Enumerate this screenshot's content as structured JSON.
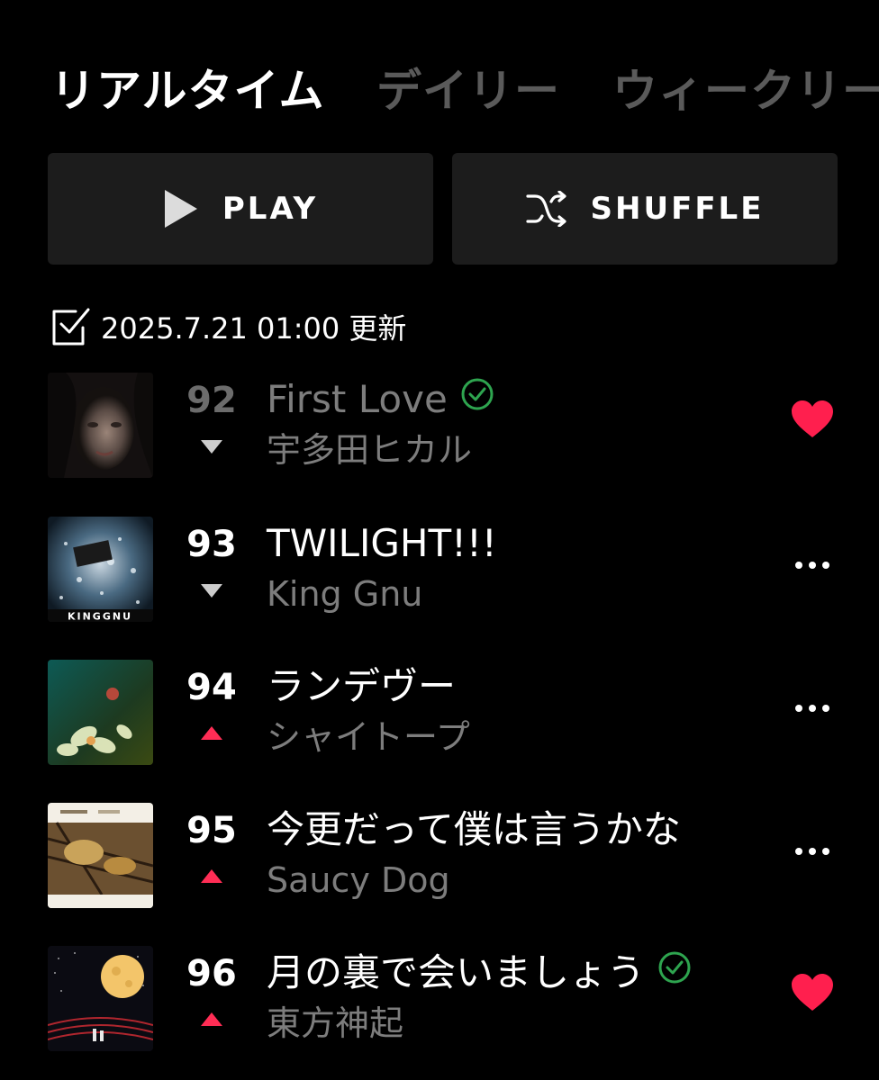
{
  "tabs": [
    {
      "label": "リアルタイム",
      "active": true
    },
    {
      "label": "デイリー",
      "active": false
    },
    {
      "label": "ウィークリー",
      "active": false
    }
  ],
  "buttons": {
    "play_label": "PLAY",
    "shuffle_label": "SHUFFLE"
  },
  "updated": {
    "text": "2025.7.21 01:00 更新",
    "icon": "checkbox-icon"
  },
  "songs": [
    {
      "rank": "92",
      "title": "First Love",
      "artist": "宇多田ヒカル",
      "trend": "down",
      "verified": true,
      "liked": true,
      "dimmed": true
    },
    {
      "rank": "93",
      "title": "TWILIGHT!!!",
      "artist": "King Gnu",
      "trend": "down",
      "verified": false,
      "liked": false,
      "dimmed": false
    },
    {
      "rank": "94",
      "title": "ランデヴー",
      "artist": "シャイトープ",
      "trend": "up",
      "verified": false,
      "liked": false,
      "dimmed": false
    },
    {
      "rank": "95",
      "title": "今更だって僕は言うかな",
      "artist": "Saucy Dog",
      "trend": "up",
      "verified": false,
      "liked": false,
      "dimmed": false
    },
    {
      "rank": "96",
      "title": "月の裏で会いましょう",
      "artist": "東方神起",
      "trend": "up",
      "verified": true,
      "liked": true,
      "dimmed": false
    }
  ],
  "colors": {
    "background": "#000000",
    "button_bg": "#1c1c1c",
    "accent_up": "#ff2d55",
    "trend_down": "#cccccc",
    "heart": "#ff1f4e",
    "verified": "#2ea44f",
    "muted_text": "#7d7d7d"
  },
  "thumb_logos": {
    "king_gnu": "KINGGNU"
  }
}
